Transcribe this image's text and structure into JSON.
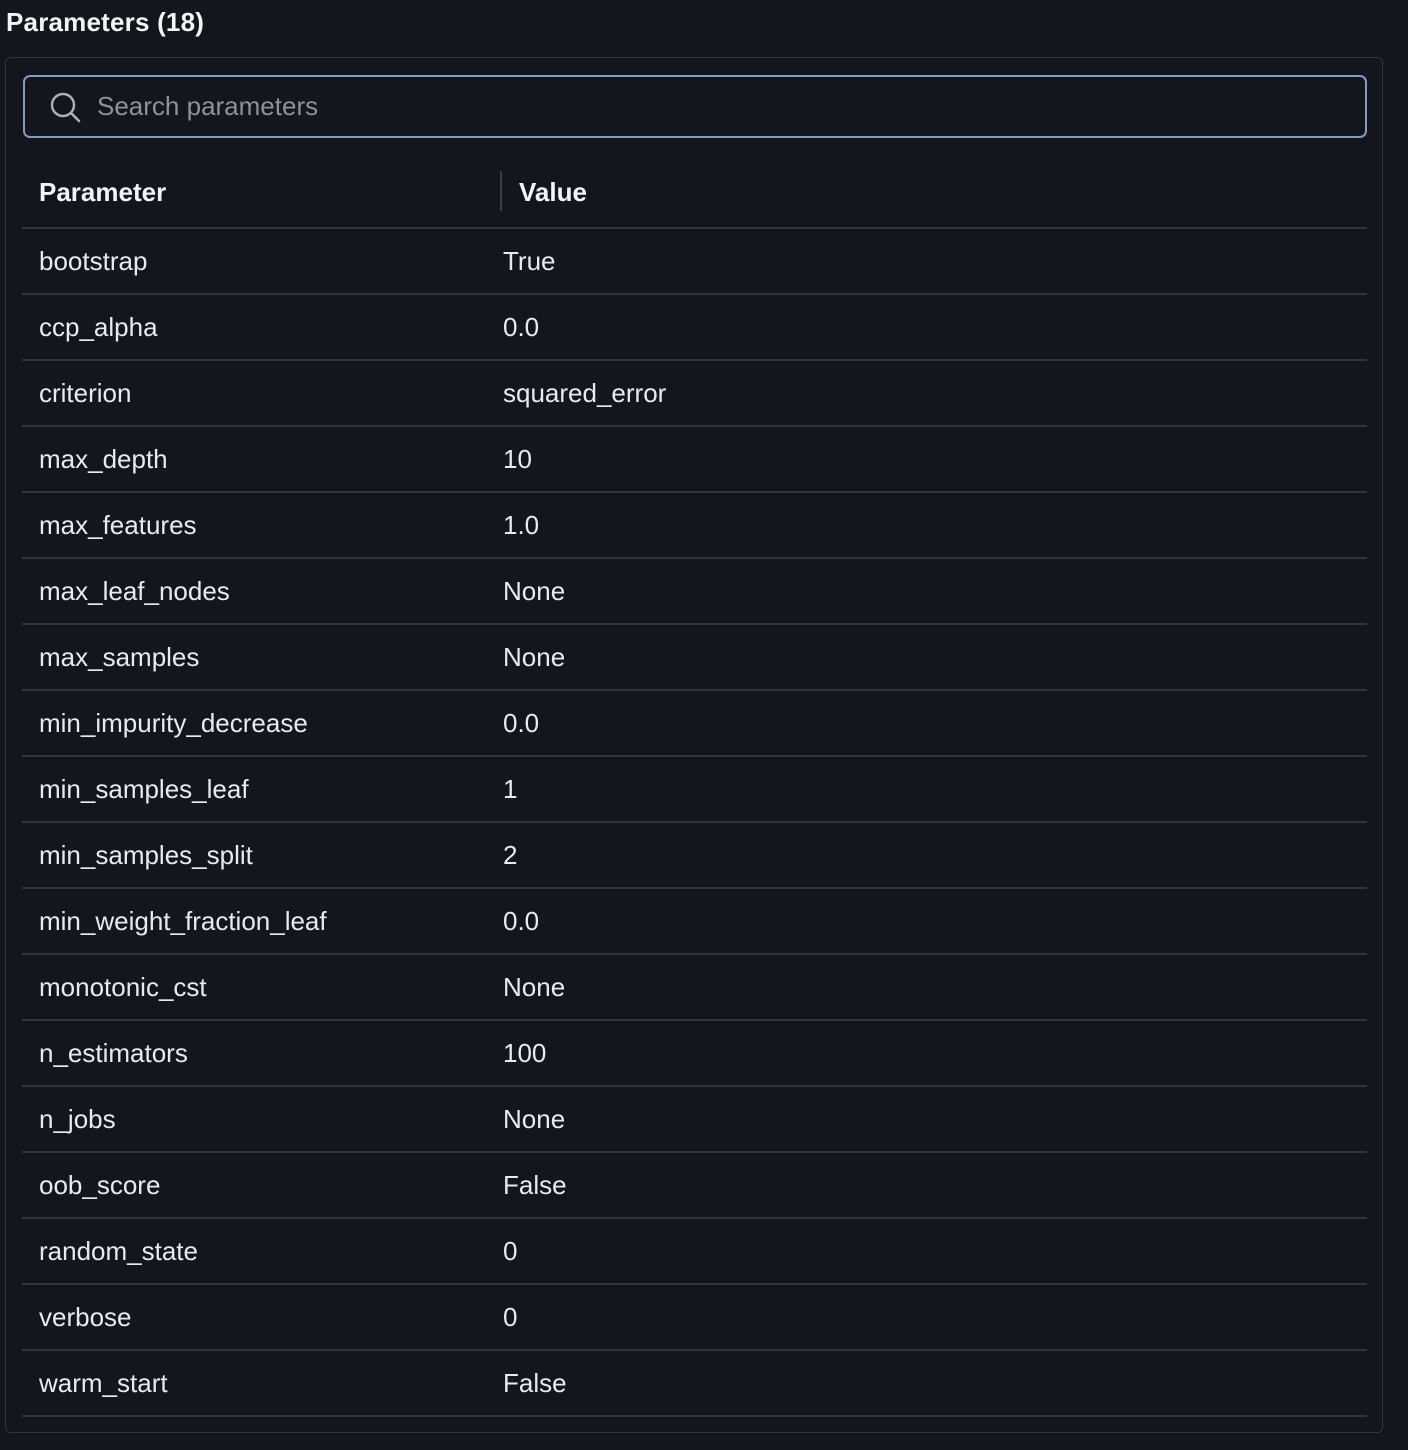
{
  "title": "Parameters (18)",
  "search": {
    "placeholder": "Search parameters",
    "value": ""
  },
  "table": {
    "headers": {
      "parameter": "Parameter",
      "value": "Value"
    },
    "rows": [
      {
        "name": "bootstrap",
        "value": "True"
      },
      {
        "name": "ccp_alpha",
        "value": "0.0"
      },
      {
        "name": "criterion",
        "value": "squared_error"
      },
      {
        "name": "max_depth",
        "value": "10"
      },
      {
        "name": "max_features",
        "value": "1.0"
      },
      {
        "name": "max_leaf_nodes",
        "value": "None"
      },
      {
        "name": "max_samples",
        "value": "None"
      },
      {
        "name": "min_impurity_decrease",
        "value": "0.0"
      },
      {
        "name": "min_samples_leaf",
        "value": "1"
      },
      {
        "name": "min_samples_split",
        "value": "2"
      },
      {
        "name": "min_weight_fraction_leaf",
        "value": "0.0"
      },
      {
        "name": "monotonic_cst",
        "value": "None"
      },
      {
        "name": "n_estimators",
        "value": "100"
      },
      {
        "name": "n_jobs",
        "value": "None"
      },
      {
        "name": "oob_score",
        "value": "False"
      },
      {
        "name": "random_state",
        "value": "0"
      },
      {
        "name": "verbose",
        "value": "0"
      },
      {
        "name": "warm_start",
        "value": "False"
      }
    ]
  },
  "icons": {
    "search": "search-icon"
  },
  "colors": {
    "background": "#13171d",
    "border": "#2f353d",
    "search_focus_border": "#7e9cc4",
    "text": "#e6ebf1",
    "placeholder": "#8a929c"
  }
}
